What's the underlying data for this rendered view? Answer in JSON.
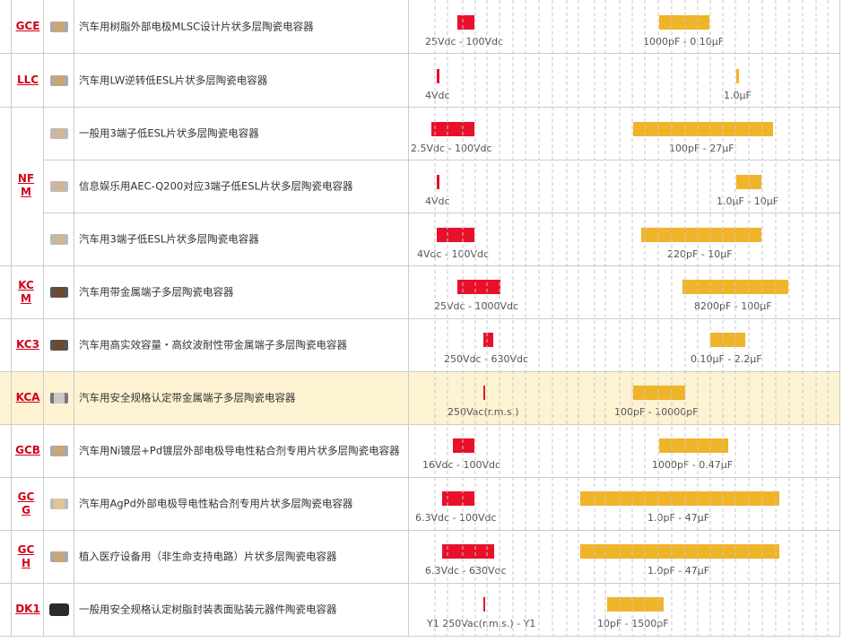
{
  "colors": {
    "voltage_bar": "#e8102b",
    "capacitance_bar": "#f0b429",
    "series_link": "#d0021b",
    "highlight_row": "#fdf3d2"
  },
  "rows": [
    {
      "series": "GCE",
      "chip": "chip-icon",
      "name": "汽车用树脂外部电极MLSC设计片状多层陶瓷电容器",
      "v_label": "25Vdc - 100Vdc",
      "c_label": "1000pF - 0.10μF"
    },
    {
      "series": "LLC",
      "chip": "chip-icon",
      "name": "汽车用LW逆转低ESL片状多层陶瓷电容器",
      "v_label": "4Vdc",
      "c_label": "1.0μF"
    },
    {
      "series": "NFM",
      "chip": "chip-icon",
      "name": "一般用3端子低ESL片状多层陶瓷电容器",
      "v_label": "2.5Vdc - 100Vdc",
      "c_label": "100pF - 27μF"
    },
    {
      "series": "",
      "chip": "chip-icon",
      "name": "信息娱乐用AEC-Q200对应3端子低ESL片状多层陶瓷电容器",
      "v_label": "4Vdc",
      "c_label": "1.0μF - 10μF"
    },
    {
      "series": "",
      "chip": "chip-icon",
      "name": "汽车用3端子低ESL片状多层陶瓷电容器",
      "v_label": "4Vdc - 100Vdc",
      "c_label": "220pF - 10μF"
    },
    {
      "series": "KCM",
      "chip": "chip-icon",
      "name": "汽车用带金属端子多层陶瓷电容器",
      "v_label": "25Vdc - 1000Vdc",
      "c_label": "8200pF - 100μF"
    },
    {
      "series": "KC3",
      "chip": "chip-icon",
      "name": "汽车用高实效容量・高纹波耐性带金属端子多层陶瓷电容器",
      "v_label": "250Vdc - 630Vdc",
      "c_label": "0.10μF - 2.2μF"
    },
    {
      "series": "KCA",
      "chip": "chip-icon",
      "name": "汽车用安全规格认定带金属端子多层陶瓷电容器",
      "v_label": "250Vac(r.m.s.)",
      "c_label": "100pF - 10000pF"
    },
    {
      "series": "GCB",
      "chip": "chip-icon",
      "name": "汽车用Ni镀层+Pd镀层外部电极导电性粘合剂专用片状多层陶瓷电容器",
      "v_label": "16Vdc - 100Vdc",
      "c_label": "1000pF - 0.47μF"
    },
    {
      "series": "GCG",
      "chip": "chip-icon",
      "name": "汽车用AgPd外部电极导电性粘合剂专用片状多层陶瓷电容器",
      "v_label": "6.3Vdc - 100Vdc",
      "c_label": "1.0pF - 47μF"
    },
    {
      "series": "GCH",
      "chip": "chip-icon",
      "name": "植入医疗设备用（非生命支持电路）片状多层陶瓷电容器",
      "v_label": "6.3Vdc - 630Vdc",
      "c_label": "1.0pF - 47μF"
    },
    {
      "series": "DK1",
      "chip": "chip-icon",
      "name": "一般用安全规格认定树脂封装表面贴装元器件陶瓷电容器",
      "v_label": "Y1 250Vac(r.m.s.) - Y1",
      "c_label": "10pF - 1500pF"
    }
  ]
}
